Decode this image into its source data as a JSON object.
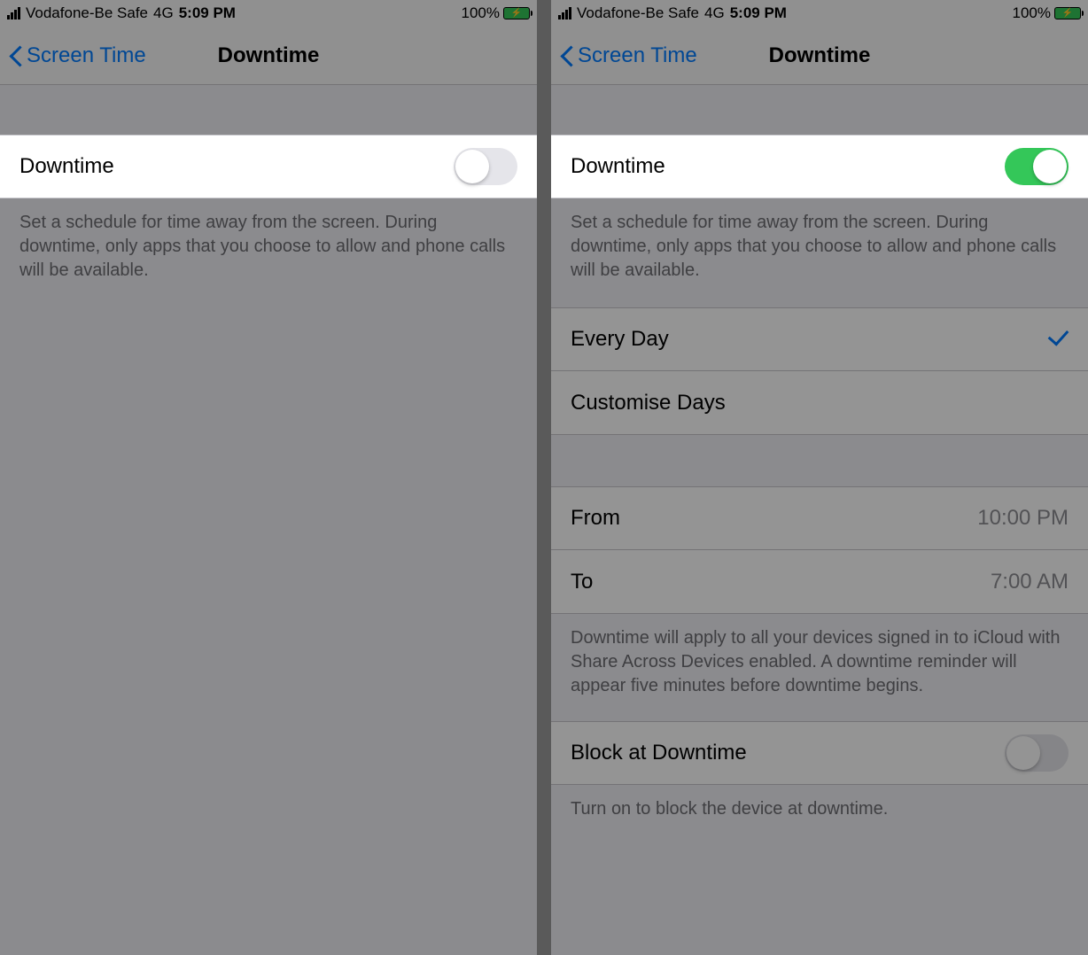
{
  "status": {
    "carrier": "Vodafone-Be Safe",
    "network": "4G",
    "time": "5:09 PM",
    "battery_pct": "100%"
  },
  "nav": {
    "back_label": "Screen Time",
    "title": "Downtime"
  },
  "left": {
    "toggle_label": "Downtime",
    "footer": "Set a schedule for time away from the screen. During downtime, only apps that you choose to allow and phone calls will be available."
  },
  "right": {
    "toggle_label": "Downtime",
    "footer": "Set a schedule for time away from the screen. During downtime, only apps that you choose to allow and phone calls will be available.",
    "every_day": "Every Day",
    "customise": "Customise Days",
    "from_label": "From",
    "from_value": "10:00 PM",
    "to_label": "To",
    "to_value": "7:00 AM",
    "devices_footer": "Downtime will apply to all your devices signed in to iCloud with Share Across Devices enabled. A downtime reminder will appear five minutes before downtime begins.",
    "block_label": "Block at Downtime",
    "block_footer": "Turn on to block the device at downtime."
  }
}
